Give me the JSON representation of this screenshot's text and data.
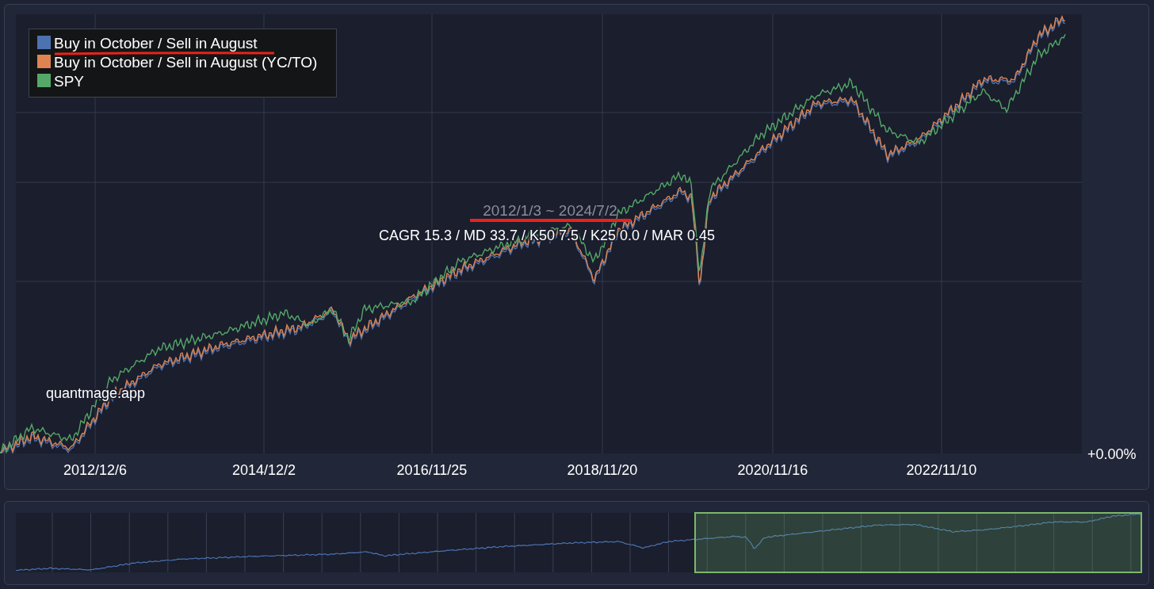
{
  "chart": {
    "legend": [
      {
        "label": "Buy in October / Sell in August",
        "color": "#4c72b0"
      },
      {
        "label": "Buy in October / Sell in August (YC/TO)",
        "color": "#dd8452"
      },
      {
        "label": "SPY",
        "color": "#55a868"
      }
    ],
    "date_range": "2012/1/3 ~ 2024/7/2",
    "stats": "CAGR 15.3 / MD 33.7 / K50 7.5 / K25 0.0 / MAR 0.45",
    "site_label": "quantmage.app",
    "x_axis_labels": [
      "2012/12/6",
      "2014/12/2",
      "2016/11/25",
      "2018/11/20",
      "2020/11/16",
      "2022/11/10"
    ],
    "y_axis_label": "+0.00%"
  }
}
